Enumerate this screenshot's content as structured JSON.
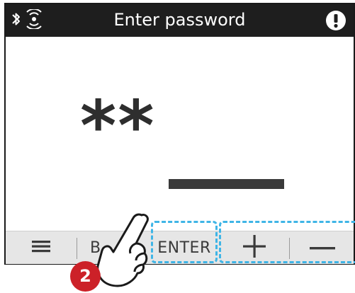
{
  "header": {
    "title": "Enter password",
    "left_icons": [
      "bluetooth-icon",
      "wireless-signal-icon"
    ],
    "right_icon": "alert-icon"
  },
  "display": {
    "masked_password": "**"
  },
  "softkeys": {
    "menu_icon": "menu-icon",
    "back_label": "B",
    "enter_label": "ENTER",
    "increase_icon": "plus-icon",
    "decrease_icon": "minus-icon"
  },
  "instruction": {
    "step_number": "2",
    "gesture_icon": "tap-hand-icon",
    "highlight_color": "#3fb5e6",
    "badge_color": "#cc2128"
  }
}
